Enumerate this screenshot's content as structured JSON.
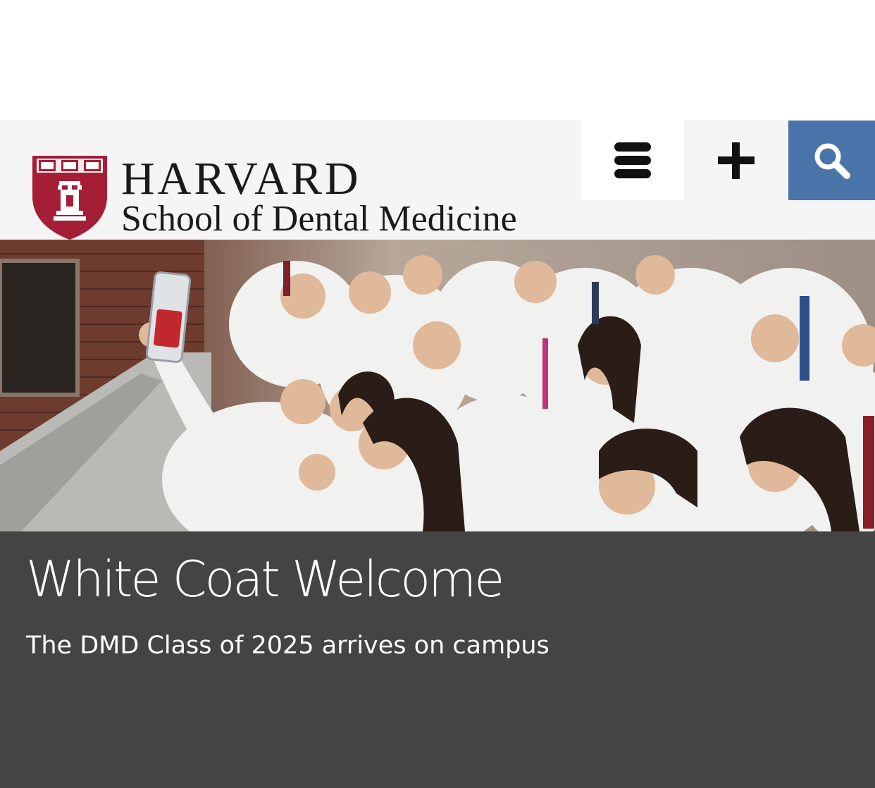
{
  "header": {
    "brand_line_1": "HARVARD",
    "brand_line_2": "School of Dental Medicine",
    "shield_motto": "VE RI TAS",
    "menu_icon": "menu-icon",
    "plus_icon": "plus-icon",
    "search_icon": "search-icon",
    "accent_color": "#4a73aa",
    "shield_color": "#a41f35"
  },
  "hero": {
    "image_icon": "photo-of-students-in-white-coats-taking-selfie"
  },
  "feature": {
    "title": "White Coat Welcome",
    "subtitle": "The DMD Class of 2025 arrives on campus",
    "background_color": "#444444"
  }
}
